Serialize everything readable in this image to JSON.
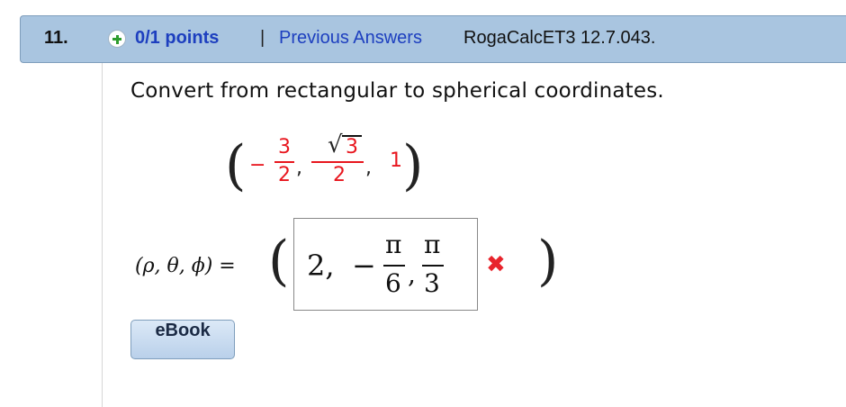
{
  "header": {
    "question_number": "11.",
    "points": "0/1 points",
    "separator": "|",
    "previous_answers": "Previous Answers",
    "problem_code": "RogaCalcET3 12.7.043."
  },
  "question": {
    "prompt": "Convert from rectangular to spherical coordinates.",
    "point": {
      "open_paren": "(",
      "close_paren": ")",
      "x_sign": "−",
      "x_num": "3",
      "x_den": "2",
      "comma": ",",
      "y_radical": "√",
      "y_num": "3",
      "y_den": "2",
      "z": "1"
    }
  },
  "answer": {
    "lhs": "(ρ, θ, ϕ) =",
    "open_paren": "(",
    "close_paren": ")",
    "rho": "2,",
    "theta_sign": "−",
    "pi": "π",
    "theta_den": "6",
    "comma": ",",
    "phi_den": "3",
    "status_icon": "x-mark-icon",
    "status_mark": "✖"
  },
  "buttons": {
    "ebook": "eBook"
  },
  "colors": {
    "header_bg": "#a9c5e0",
    "link": "#1d3fbf",
    "given_values": "#e8161e",
    "wrong": "#e8242c"
  }
}
